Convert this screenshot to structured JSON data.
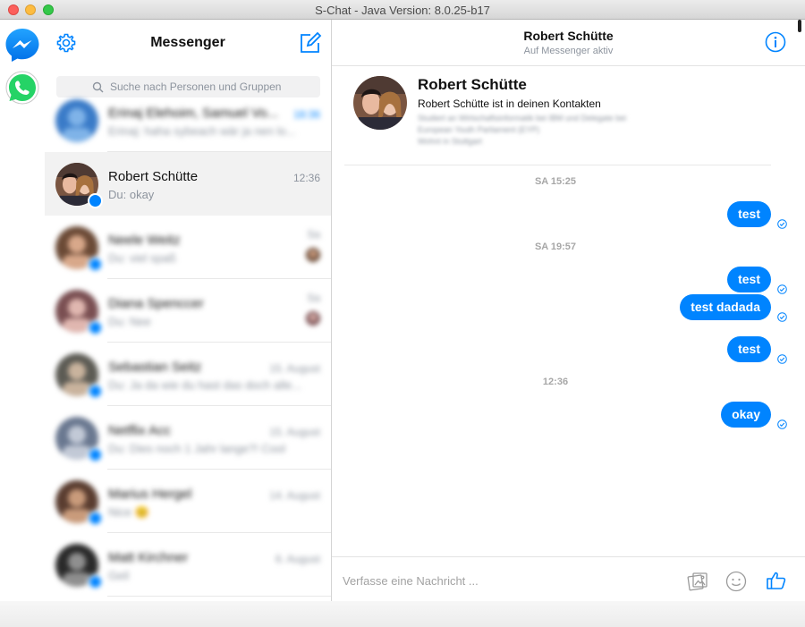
{
  "window": {
    "title": "S-Chat - Java Version: 8.0.25-b17"
  },
  "apps": [
    {
      "name": "Messenger",
      "icon": "messenger-icon"
    },
    {
      "name": "WhatsApp",
      "icon": "whatsapp-icon"
    }
  ],
  "sidebar": {
    "title": "Messenger",
    "search_placeholder": "Suche nach Personen und Gruppen",
    "conversations": [
      {
        "name": "Erinaj Elehoim, Samuel Vo...",
        "snippet": "Erinaj: haha sybeach wär ja nen lo...",
        "time": "18:36",
        "blurred": true,
        "active": false,
        "unread": true
      },
      {
        "name": "Robert Schütte",
        "snippet": "Du: okay",
        "time": "12:36",
        "blurred": false,
        "active": true,
        "unread": false
      },
      {
        "name": "Neele Weitz",
        "snippet": "Du: viel spaß",
        "time": "Sa",
        "blurred": true,
        "active": false,
        "unread": false
      },
      {
        "name": "Diana Spenccer",
        "snippet": "Du: Nee",
        "time": "Sa",
        "blurred": true,
        "active": false,
        "unread": false
      },
      {
        "name": "Sebastian Seitz",
        "snippet": "Du: Ja da wie du hast das doch alle...",
        "time": "15. August",
        "blurred": true,
        "active": false,
        "unread": false
      },
      {
        "name": "Netflix Acc",
        "snippet": "Du: Dies noch 1 Jahr lange?! Cool",
        "time": "15. August",
        "blurred": true,
        "active": false,
        "unread": false
      },
      {
        "name": "Marius Hergel",
        "snippet": "Nice 😊",
        "time": "14. August",
        "blurred": true,
        "active": false,
        "unread": false
      },
      {
        "name": "Matt Kirchner",
        "snippet": "Geil",
        "time": "6. August",
        "blurred": true,
        "active": false,
        "unread": false
      }
    ]
  },
  "chat": {
    "name": "Robert Schütte",
    "status": "Auf Messenger aktiv",
    "profile": {
      "name": "Robert Schütte",
      "line": "Robert Schütte ist in deinen Kontakten",
      "blurred_lines": [
        "Studiert an Wirtschaftsinformatik bei IBM und Delegate bei",
        "European Youth Parliament (EYP)",
        "Wohnt in Stuttgart"
      ]
    },
    "messages": [
      {
        "type": "day",
        "text": "SA 15:25"
      },
      {
        "type": "msg",
        "text": "test"
      },
      {
        "type": "day",
        "text": "SA 19:57"
      },
      {
        "type": "msg",
        "text": "test"
      },
      {
        "type": "msg",
        "text": "test dadada"
      },
      {
        "type": "msg",
        "text": "test"
      },
      {
        "type": "day",
        "text": "12:36"
      },
      {
        "type": "msg",
        "text": "okay"
      }
    ],
    "composer_placeholder": "Verfasse eine Nachricht ..."
  },
  "colors": {
    "accent": "#0084ff",
    "bubble_text": "#ffffff",
    "muted": "#8d949e",
    "whatsapp": "#25d366"
  }
}
